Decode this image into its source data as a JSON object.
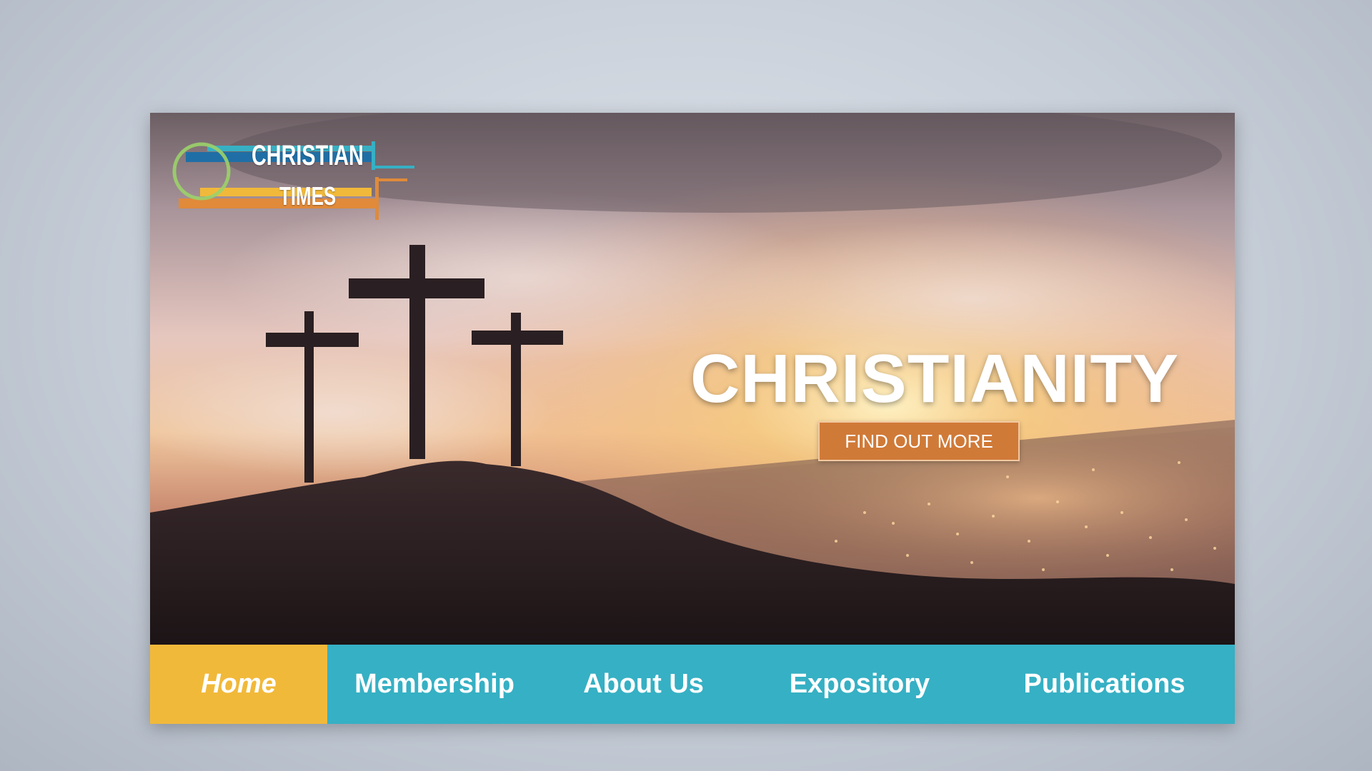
{
  "logo": {
    "line1": "CHRISTIAN",
    "line2": "TIMES",
    "colors": {
      "blue": "#1f6fa6",
      "teal": "#36b0c4",
      "orange": "#e08a3a",
      "yellow": "#f1b93a",
      "green": "#9bd26a"
    }
  },
  "hero": {
    "title": "CHRISTIANITY",
    "cta_label": "FIND OUT MORE"
  },
  "nav": {
    "items": [
      {
        "label": "Home",
        "active": true
      },
      {
        "label": "Membership",
        "active": false
      },
      {
        "label": "About Us",
        "active": false
      },
      {
        "label": "Expository",
        "active": false
      },
      {
        "label": "Publications",
        "active": false
      }
    ]
  },
  "colors": {
    "nav_bg": "#36b0c4",
    "nav_active": "#f1b93a",
    "cta_bg": "#d07a38",
    "text": "#ffffff"
  }
}
